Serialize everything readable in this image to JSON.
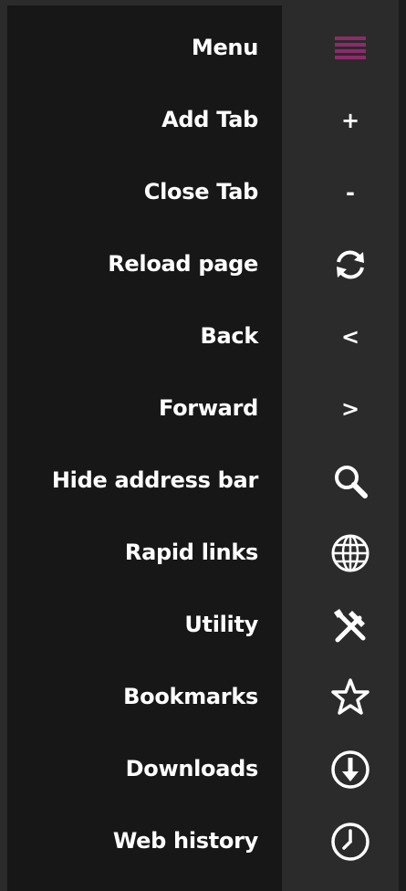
{
  "colors": {
    "label_panel_bg": "#171717",
    "icon_panel_bg": "#2b2b2b",
    "text": "#ffffff",
    "accent": "#8e2a6b"
  },
  "menu": {
    "items": [
      {
        "label": "Menu",
        "icon": "hamburger-icon"
      },
      {
        "label": "Add Tab",
        "icon": "plus-icon"
      },
      {
        "label": "Close Tab",
        "icon": "minus-icon"
      },
      {
        "label": "Reload page",
        "icon": "reload-icon"
      },
      {
        "label": "Back",
        "icon": "chevron-left-icon"
      },
      {
        "label": "Forward",
        "icon": "chevron-right-icon"
      },
      {
        "label": "Hide address bar",
        "icon": "search-icon"
      },
      {
        "label": "Rapid links",
        "icon": "globe-icon"
      },
      {
        "label": "Utility",
        "icon": "tools-icon"
      },
      {
        "label": "Bookmarks",
        "icon": "star-icon"
      },
      {
        "label": "Downloads",
        "icon": "download-icon"
      },
      {
        "label": "Web history",
        "icon": "clock-icon"
      }
    ],
    "glyphs": {
      "add": "+",
      "close": "-",
      "back": "<",
      "forward": ">"
    }
  }
}
